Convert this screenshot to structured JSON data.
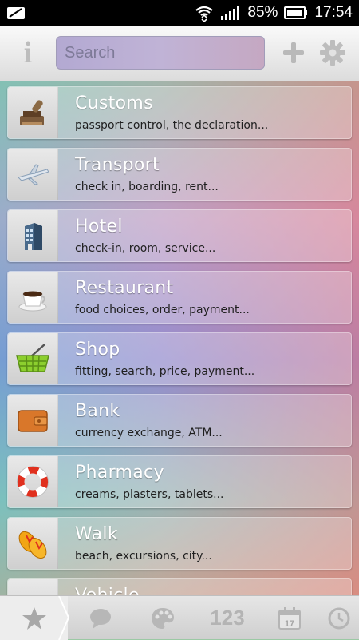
{
  "status_bar": {
    "battery_percent": "85%",
    "time": "17:54"
  },
  "header": {
    "search_placeholder": "Search"
  },
  "categories": [
    {
      "title": "Customs",
      "subtitle": "passport control, the declaration...",
      "icon": "stamp-icon"
    },
    {
      "title": "Transport",
      "subtitle": "check in, boarding, rent...",
      "icon": "airplane-icon"
    },
    {
      "title": "Hotel",
      "subtitle": "check-in, room, service...",
      "icon": "building-icon"
    },
    {
      "title": "Restaurant",
      "subtitle": "food choices, order, payment...",
      "icon": "coffee-cup-icon"
    },
    {
      "title": "Shop",
      "subtitle": "fitting, search, price, payment...",
      "icon": "shopping-basket-icon"
    },
    {
      "title": "Bank",
      "subtitle": "currency exchange, ATM...",
      "icon": "wallet-icon"
    },
    {
      "title": "Pharmacy",
      "subtitle": "creams, plasters, tablets...",
      "icon": "lifebuoy-icon"
    },
    {
      "title": "Walk",
      "subtitle": "beach, excursions, city...",
      "icon": "flip-flops-icon"
    },
    {
      "title": "Vehicle",
      "subtitle": "",
      "icon": "vehicle-icon"
    }
  ],
  "bottom_tabs": [
    {
      "name": "favorites-tab",
      "icon": "star-icon"
    },
    {
      "name": "phrases-tab",
      "icon": "speech-bubble-icon"
    },
    {
      "name": "colors-tab",
      "icon": "palette-icon"
    },
    {
      "name": "numbers-tab",
      "icon": "numbers-icon",
      "label": "123"
    },
    {
      "name": "calendar-tab",
      "icon": "calendar-icon",
      "label": "17"
    },
    {
      "name": "time-tab",
      "icon": "clock-icon"
    }
  ],
  "colors": {
    "topbar": "#e8e8e8",
    "search_bg": "#bcb0d5",
    "item_title": "#ffffff",
    "item_subtitle": "#1f1f1f"
  }
}
